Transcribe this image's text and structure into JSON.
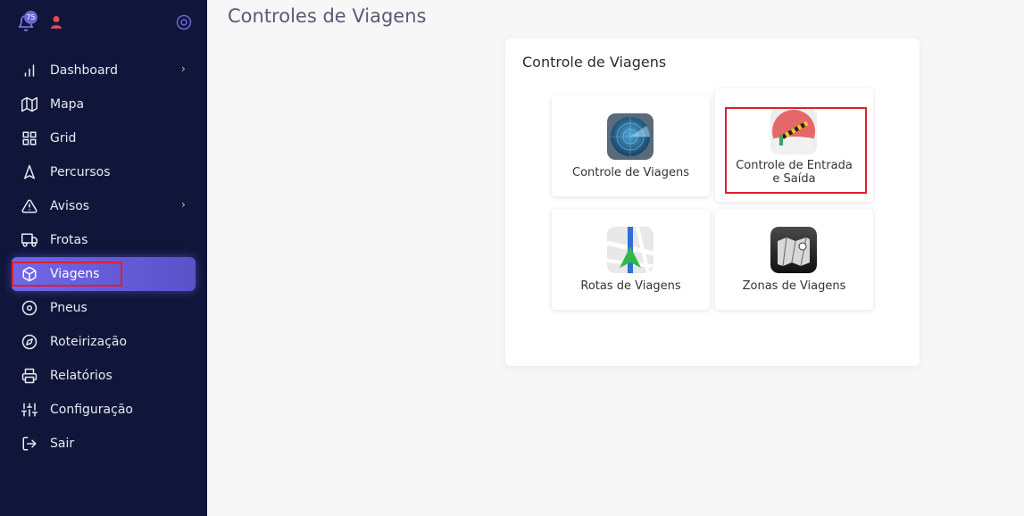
{
  "header": {
    "notification_count": "75",
    "page_title": "Controles de Viagens"
  },
  "sidebar": {
    "items": [
      {
        "label": "Dashboard",
        "icon": "bar-chart-icon",
        "has_submenu": true
      },
      {
        "label": "Mapa",
        "icon": "map-icon",
        "has_submenu": false
      },
      {
        "label": "Grid",
        "icon": "grid-icon",
        "has_submenu": false
      },
      {
        "label": "Percursos",
        "icon": "navigation-icon",
        "has_submenu": false
      },
      {
        "label": "Avisos",
        "icon": "alert-triangle-icon",
        "has_submenu": true
      },
      {
        "label": "Frotas",
        "icon": "truck-icon",
        "has_submenu": false
      },
      {
        "label": "Viagens",
        "icon": "package-icon",
        "has_submenu": false,
        "active": true
      },
      {
        "label": "Pneus",
        "icon": "disc-icon",
        "has_submenu": false
      },
      {
        "label": "Roteirização",
        "icon": "compass-icon",
        "has_submenu": false
      },
      {
        "label": "Relatórios",
        "icon": "printer-icon",
        "has_submenu": false
      },
      {
        "label": "Configuração",
        "icon": "sliders-icon",
        "has_submenu": false
      },
      {
        "label": "Sair",
        "icon": "logout-icon",
        "has_submenu": false
      }
    ]
  },
  "card": {
    "title": "Controle de Viagens",
    "tiles": [
      {
        "label": "Controle de Viagens",
        "icon": "radar-icon"
      },
      {
        "label": "Controle de Entrada e Saída",
        "icon": "barrier-gate-icon"
      },
      {
        "label": "Rotas de Viagens",
        "icon": "route-map-icon"
      },
      {
        "label": "Zonas de Viagens",
        "icon": "zone-map-icon"
      }
    ]
  },
  "colors": {
    "sidebar_bg": "#10163a",
    "active_item": "#6a60e0",
    "highlight": "#e0202a",
    "badge": "#6a66d9"
  }
}
